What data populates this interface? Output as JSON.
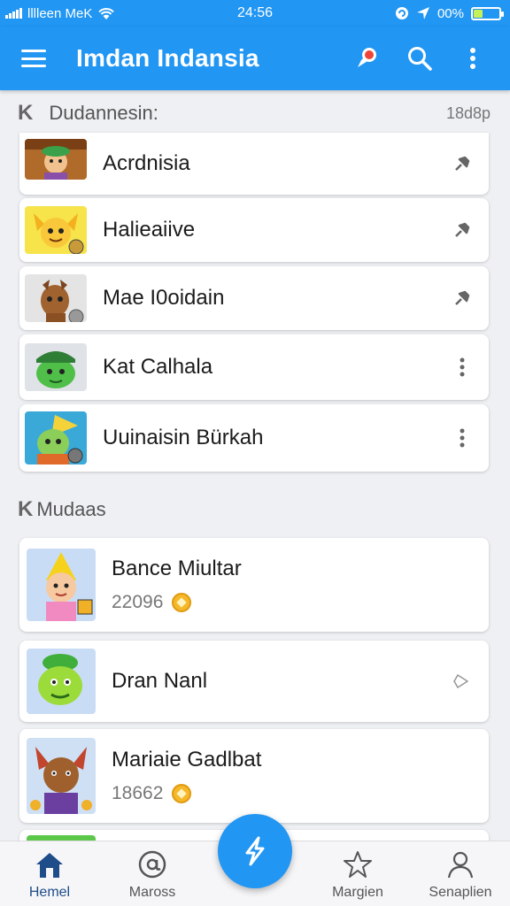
{
  "status_bar": {
    "carrier": "lllleen MeK",
    "time": "24:56",
    "battery": "00%",
    "battery_fill": 0.35
  },
  "app_bar": {
    "title": "Imdan Indansia",
    "menu_icon": "hamburger-menu-icon",
    "actions": [
      "notification-icon",
      "search-icon",
      "more-vert-icon"
    ]
  },
  "section1": {
    "title": "Dudannesin:",
    "count": "18d8p",
    "items": [
      {
        "title": "Acrdnisia",
        "action_icon": "pin-icon"
      },
      {
        "title": "Halieaiive",
        "action_icon": "pin-icon"
      },
      {
        "title": "Mae I0oidain",
        "action_icon": "pin-icon"
      },
      {
        "title": "Kat Calhala",
        "action_icon": "more-vert-icon"
      },
      {
        "title": "Uuinaisin Bürkah",
        "action_icon": "more-vert-icon"
      }
    ]
  },
  "section2": {
    "title": "Mudaas",
    "items": [
      {
        "title": "Bance Miultar",
        "subtitle": "22096",
        "badge_icon": "coin-icon"
      },
      {
        "title": "Dran Nanl",
        "action_icon": "chevron-icon"
      },
      {
        "title": "Mariaie Gadlbat",
        "subtitle": "18662",
        "badge_icon": "coin-icon"
      }
    ]
  },
  "bottom_nav": {
    "items": [
      {
        "label": "Hemel",
        "icon": "home-icon",
        "active": true
      },
      {
        "label": "Maross",
        "icon": "at-icon",
        "active": false
      },
      {
        "label": "Margien",
        "icon": "star-icon",
        "active": false
      },
      {
        "label": "Senaplien",
        "icon": "person-icon",
        "active": false
      }
    ],
    "fab_icon": "lightning-icon"
  },
  "colors": {
    "primary": "#2196f3",
    "active_nav": "#1f4d8a",
    "coin": "#f5b82a"
  }
}
